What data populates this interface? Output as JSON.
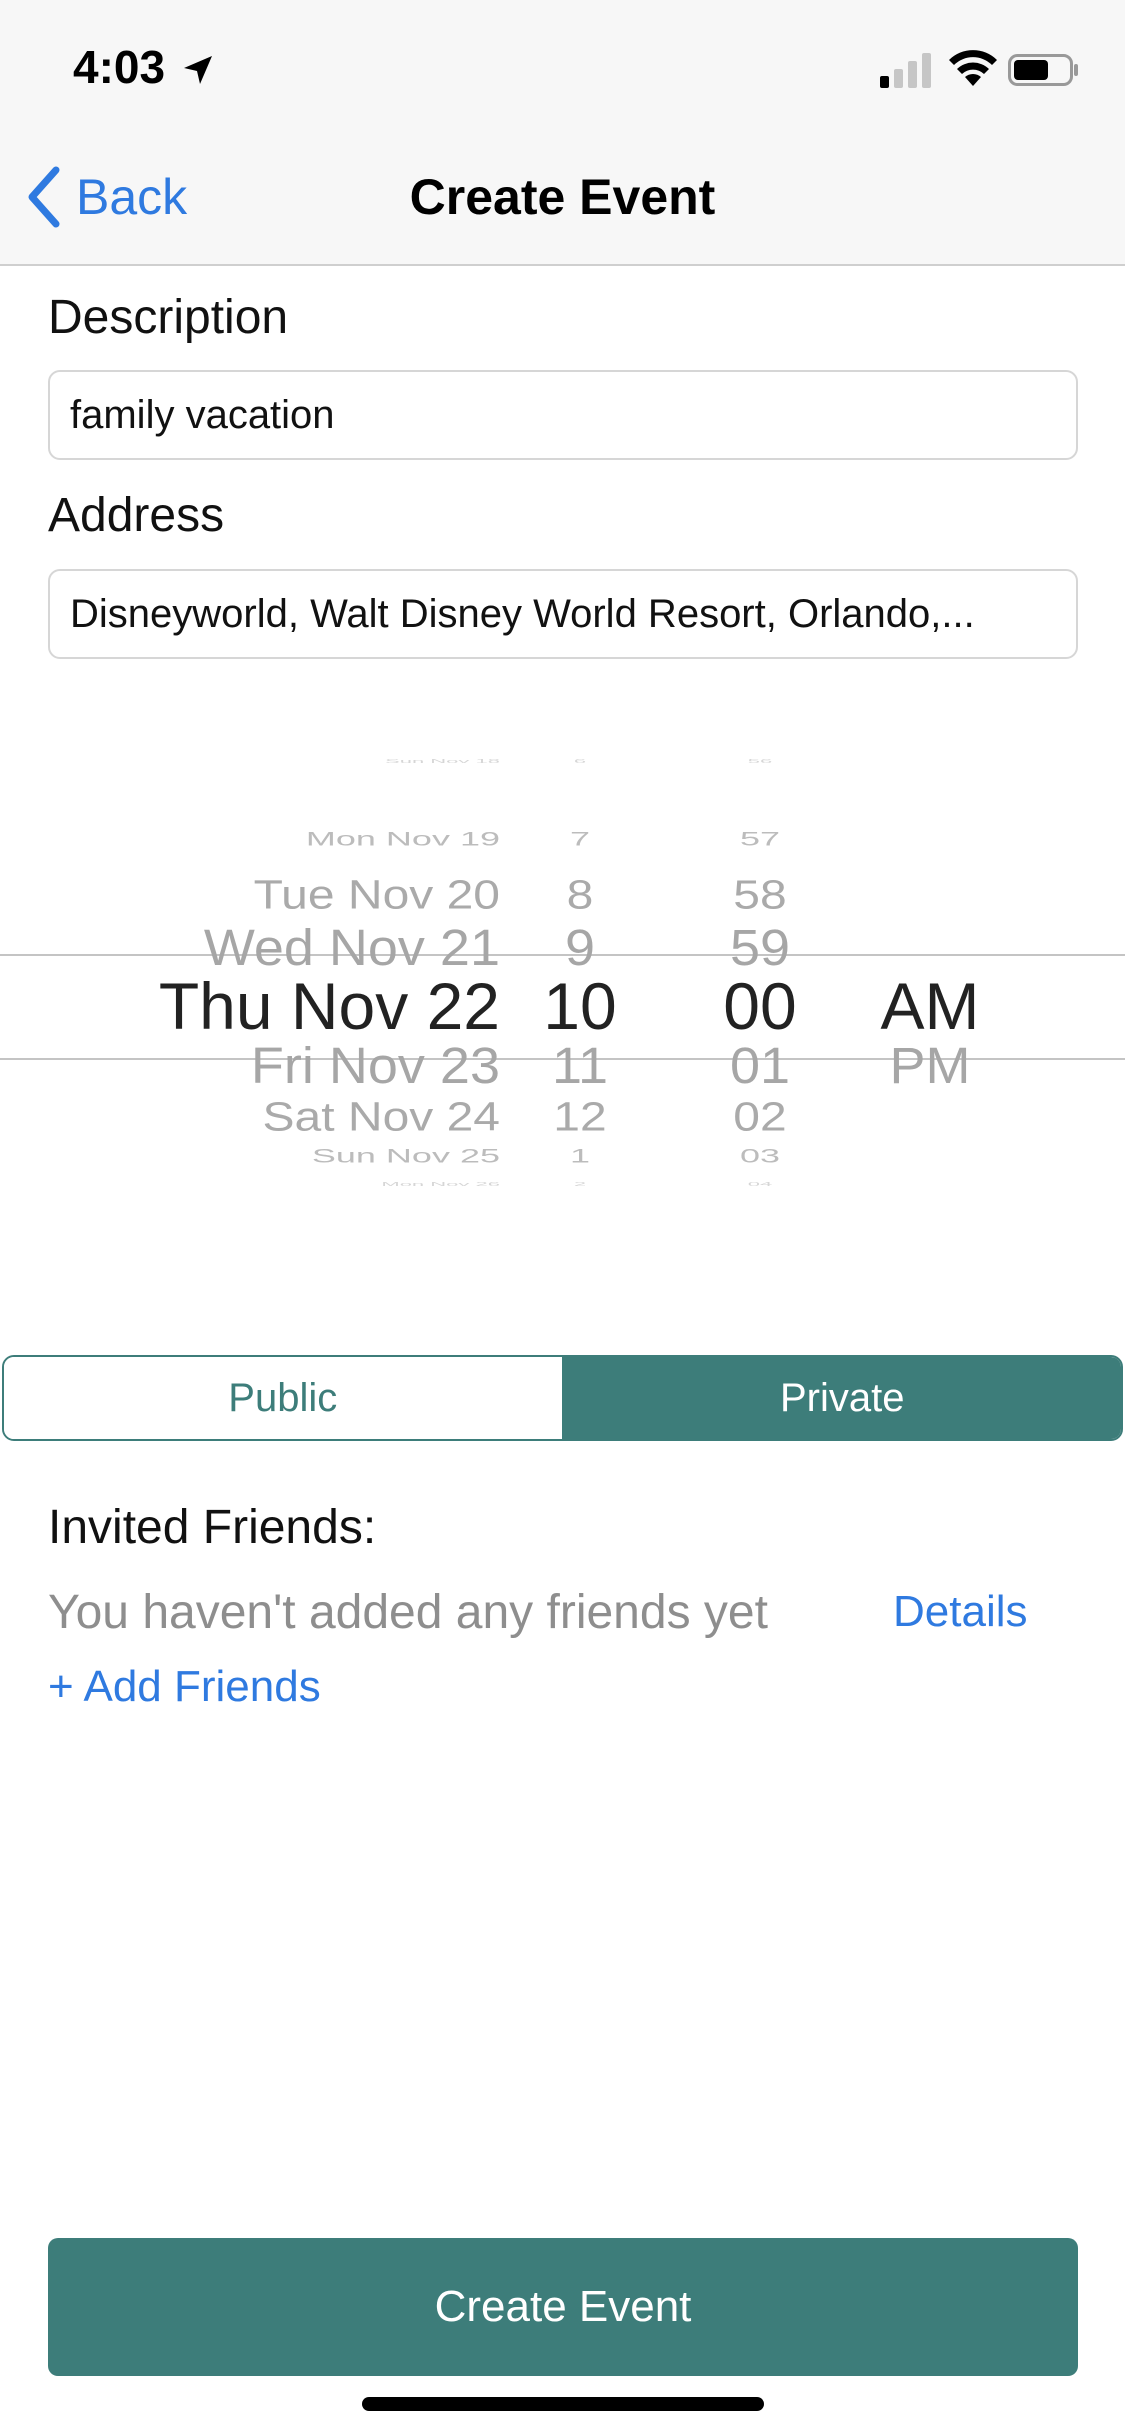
{
  "status_bar": {
    "time": "4:03"
  },
  "nav": {
    "back_label": "Back",
    "title": "Create Event"
  },
  "form": {
    "description_label": "Description",
    "description_value": "family vacation",
    "address_label": "Address",
    "address_value": "Disneyworld, Walt Disney World Resort, Orlando,..."
  },
  "picker": {
    "dates": [
      "Sun Nov 18",
      "Mon Nov 19",
      "Tue Nov 20",
      "Wed Nov 21",
      "Thu Nov 22",
      "Fri Nov 23",
      "Sat Nov 24",
      "Sun Nov 25",
      "Mon Nov 26"
    ],
    "hours": [
      "6",
      "7",
      "8",
      "9",
      "10",
      "11",
      "12",
      "1",
      "2"
    ],
    "minutes": [
      "56",
      "57",
      "58",
      "59",
      "00",
      "01",
      "02",
      "03",
      "04"
    ],
    "ampm": [
      "AM",
      "PM"
    ],
    "selected": {
      "date": "Thu Nov 22",
      "hour": "10",
      "minute": "00",
      "ampm": "AM"
    }
  },
  "visibility": {
    "options": [
      "Public",
      "Private"
    ],
    "selected": "Private"
  },
  "friends": {
    "title": "Invited Friends:",
    "empty_text": "You haven't added any friends yet",
    "details_label": "Details",
    "add_label": "+ Add Friends"
  },
  "submit_label": "Create Event",
  "colors": {
    "accent": "#3d7d7a",
    "link": "#2f7ae0"
  }
}
